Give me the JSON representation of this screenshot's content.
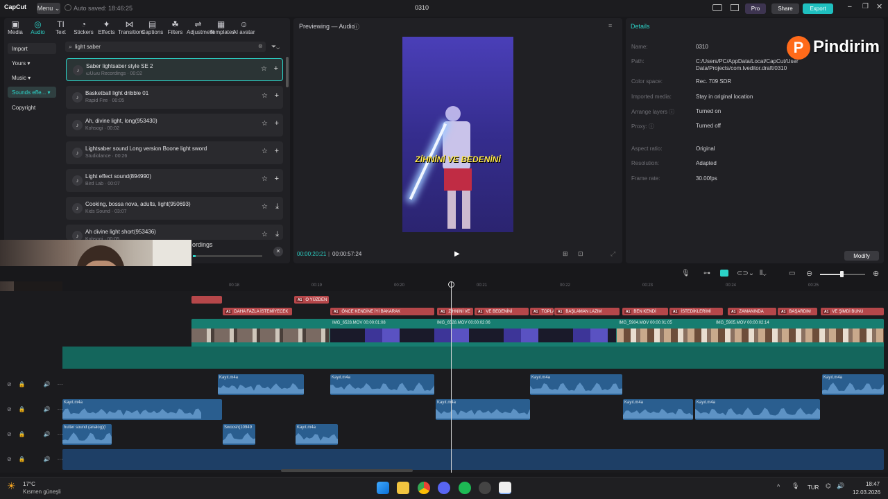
{
  "app": {
    "logo": "CapCut",
    "menu": "Menu",
    "autosave": "Auto saved: 18:46:25",
    "title": "0310",
    "pro": "Pro",
    "share": "Share",
    "export": "Export"
  },
  "toolbar": [
    {
      "label": "Media",
      "icon": "▣"
    },
    {
      "label": "Audio",
      "icon": "◎"
    },
    {
      "label": "Text",
      "icon": "TI"
    },
    {
      "label": "Stickers",
      "icon": "◔"
    },
    {
      "label": "Effects",
      "icon": "✦"
    },
    {
      "label": "Transitions",
      "icon": "⋈"
    },
    {
      "label": "Captions",
      "icon": "▤"
    },
    {
      "label": "Filters",
      "icon": "☘"
    },
    {
      "label": "Adjustment",
      "icon": "⇌"
    },
    {
      "label": "Templates",
      "icon": "▦"
    },
    {
      "label": "AI avatar",
      "icon": "☺"
    }
  ],
  "sidebar": {
    "items": [
      {
        "label": "Import"
      },
      {
        "label": "Yours ▾"
      },
      {
        "label": "Music ▾"
      },
      {
        "label": "Sounds effe... ▾"
      },
      {
        "label": "Copyright"
      }
    ]
  },
  "search": {
    "value": "light saber"
  },
  "sounds": [
    {
      "name": "Saber lightsaber style SE 2",
      "sub": "ωUωu Recordings · 00:02",
      "action": "+"
    },
    {
      "name": "Basketball light dribble 01",
      "sub": "Rapid Fire · 00:05",
      "action": "+"
    },
    {
      "name": "Ah, divine light, long(953430)",
      "sub": "Kohsogi · 00:02",
      "action": "+"
    },
    {
      "name": "Lightsaber sound Long version Boone light sword",
      "sub": "Studiolance · 00:26",
      "action": "+"
    },
    {
      "name": "Light effect sound(894990)",
      "sub": "Bird Lab · 00:07",
      "action": "+"
    },
    {
      "name": "Cooking, bossa nova, adults, light(950693)",
      "sub": "Kids Sound · 03:07",
      "action": "⤓"
    },
    {
      "name": "Ah divine light short(953436)",
      "sub": "Kohsogi · 00:05",
      "action": "⤓"
    }
  ],
  "player": {
    "header": "Previewing — Audio",
    "caption": "ZİHNİNİ VE BEDENİNİ",
    "current": "00:00:20:21",
    "total": "00:00:57:24",
    "popup_text": "ordings"
  },
  "details": {
    "title": "Details",
    "rows": [
      {
        "label": "Name:",
        "value": "0310"
      },
      {
        "label": "Path:",
        "value": "C:/Users/PC/AppData/Local/CapCut/User Data/Projects/com.lveditor.draft/0310"
      },
      {
        "label": "Color space:",
        "value": "Rec. 709 SDR"
      },
      {
        "label": "Imported media:",
        "value": "Stay in original location"
      },
      {
        "label": "Arrange layers ⓘ",
        "value": "Turned on"
      },
      {
        "label": "Proxy: ⓘ",
        "value": "Turned off"
      },
      {
        "label": "Aspect ratio:",
        "value": "Original"
      },
      {
        "label": "Resolution:",
        "value": "Adapted"
      },
      {
        "label": "Frame rate:",
        "value": "30.00fps"
      }
    ],
    "modify": "Modify"
  },
  "watermark": "Pindirim",
  "timeline": {
    "ticks": [
      "00:18",
      "00:19",
      "00:20",
      "00:21",
      "00:22",
      "00:23",
      "00:24",
      "00:25"
    ],
    "captions_top": [
      {
        "text": "O YÜZDEN"
      }
    ],
    "captions": [
      {
        "text": "DAHA FAZLA İSTEMİYECEK"
      },
      {
        "text": "ÖNCE KENDİNE İYİ BAKARAK"
      },
      {
        "text": "ZİHNİNİ VE"
      },
      {
        "text": "VE BEDENİNİ"
      },
      {
        "text": "TOPLA"
      },
      {
        "text": "BAŞLAMAN LAZIM"
      },
      {
        "text": "BEN KENDİ"
      },
      {
        "text": "İSTEDİKLERİMİ"
      },
      {
        "text": "ZAMANINDA"
      },
      {
        "text": "BAŞARDIM"
      },
      {
        "text": "VE ŞİMDİ BUNU"
      }
    ],
    "video_clips": [
      {
        "label": "IMG_6528.MOV  00:00:01:08"
      },
      {
        "label": "IMG_6528.MOV  00:00:02:06"
      },
      {
        "label": "IMG_5904.MOV  00:00:01:05"
      },
      {
        "label": "IMG_5905.MOV  00:00:02:14"
      }
    ],
    "audio1": [
      {
        "label": "Kayıt.m4a"
      },
      {
        "label": "Kayıt.m4a"
      },
      {
        "label": "Kayıt.m4a"
      },
      {
        "label": "Kayıt.m4a"
      }
    ],
    "audio2": [
      {
        "label": "Kayıt.m4a"
      },
      {
        "label": "Kayıt.m4a"
      },
      {
        "label": "Kayıt.m4a"
      },
      {
        "label": "Kayıt.m4a"
      }
    ],
    "audio3": [
      {
        "label": "hutter sound (analog)(l"
      },
      {
        "label": "Swoosh(10949"
      },
      {
        "label": "Kayıt.m4a"
      }
    ]
  },
  "taskbar": {
    "temp": "17°C",
    "weather": "Kısmen güneşli",
    "lang": "TUR",
    "time": "18:47",
    "date": "12.03.2026"
  }
}
